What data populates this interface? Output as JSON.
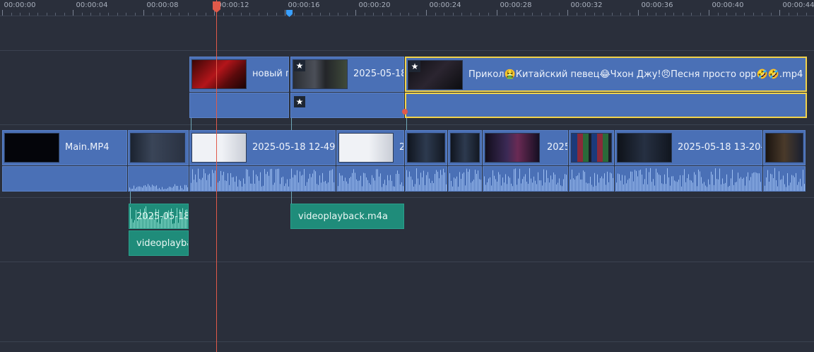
{
  "ruler": {
    "ticks": [
      "00:00:00",
      "00:00:04",
      "00:00:08",
      "00:00:12",
      "00:00:16",
      "00:00:20",
      "00:00:24",
      "00:00:28",
      "00:00:32",
      "00:00:36",
      "00:00:40",
      "00:00:44"
    ]
  },
  "overlay_track": {
    "clips": [
      {
        "name": "новый п"
      },
      {
        "name": "2025-05-18"
      },
      {
        "name": "Прикол🤮Китайский певец😂Чхон Джу!😠Песня просто орр🤣🤣.mp4"
      }
    ]
  },
  "main_track": {
    "clips": [
      {
        "name": "Main.MP4"
      },
      {
        "name": ""
      },
      {
        "name": "2025-05-18 12-49-"
      },
      {
        "name": "2"
      },
      {
        "name": ""
      },
      {
        "name": ""
      },
      {
        "name": "2025"
      },
      {
        "name": ""
      },
      {
        "name": "2025-05-18 13-20-"
      },
      {
        "name": ""
      }
    ]
  },
  "audio_track": {
    "clips": [
      {
        "name": "2025-05-18"
      },
      {
        "name": "videoplayba"
      },
      {
        "name": "videoplayback.m4a"
      }
    ]
  },
  "icons": {
    "star": "star-icon"
  },
  "colors": {
    "background": "#2a2f3b",
    "video_clip": "#4a70b6",
    "audio_clip": "#1f8c7a",
    "playhead": "#e05a4a",
    "selection": "#f2d34b",
    "marker": "#3aa0ff"
  }
}
